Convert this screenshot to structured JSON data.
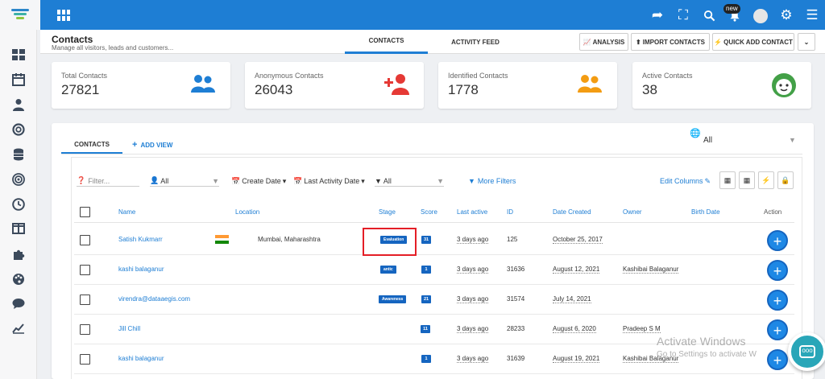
{
  "topbar": {
    "new_badge": "new",
    "icons": [
      "share-icon",
      "fullscreen-icon",
      "search-icon",
      "bell-icon",
      "avatar",
      "gear-icon",
      "menu-icon"
    ]
  },
  "sidebar": {
    "items": [
      "dashboard-icon",
      "calendar-icon",
      "user-icon",
      "lifebuoy-icon",
      "database-icon",
      "target-icon",
      "clock-icon",
      "columns-icon",
      "puzzle-icon",
      "palette-icon",
      "chat-icon",
      "trend-icon"
    ]
  },
  "header": {
    "title": "Contacts",
    "subtitle": "Manage all visitors, leads and customers...",
    "tabs": [
      {
        "label": "CONTACTS",
        "active": true
      },
      {
        "label": "ACTIVITY FEED",
        "active": false
      }
    ],
    "buttons": {
      "analysis": "ANALYSIS",
      "import": "IMPORT CONTACTS",
      "quick_add": "QUICK ADD CONTACT"
    }
  },
  "stats": [
    {
      "label": "Total Contacts",
      "value": "27821",
      "icon": "users-icon",
      "color": "#1e7ed4"
    },
    {
      "label": "Anonymous Contacts",
      "value": "26043",
      "icon": "add-user-icon",
      "color": "#e53935"
    },
    {
      "label": "Identified Contacts",
      "value": "1778",
      "icon": "users-icon",
      "color": "#f39c12"
    },
    {
      "label": "Active Contacts",
      "value": "38",
      "icon": "smiley-icon",
      "color": "#43a047"
    }
  ],
  "panel": {
    "tabs": {
      "contacts": "CONTACTS",
      "add_view": "ADD VIEW"
    },
    "scope": "All",
    "filters": {
      "filter_placeholder": "Filter...",
      "owner": "All",
      "create_date": "Create Date",
      "last_activity": "Last Activity Date",
      "type": "All",
      "more": "More Filters",
      "edit_columns": "Edit Columns"
    }
  },
  "table": {
    "columns": [
      "Name",
      "Location",
      "Stage",
      "Score",
      "Last active",
      "ID",
      "Date Created",
      "Owner",
      "Birth Date",
      "Action"
    ],
    "rows": [
      {
        "name": "Satish Kukmarr",
        "location": "Mumbai, Maharashtra",
        "stage": "Evaluation",
        "score": "31",
        "last_active": "3 days ago",
        "id": "125",
        "date_created": "October 25, 2017",
        "owner": "",
        "birth_date": ""
      },
      {
        "name": "kashi balaganur",
        "location": "",
        "stage": "antic",
        "score": "1",
        "last_active": "3 days ago",
        "id": "31636",
        "date_created": "August 12, 2021",
        "owner": "Kashibai Balaganur",
        "birth_date": ""
      },
      {
        "name": "virendra@dataaegis.com",
        "location": "",
        "stage": "Awareness",
        "score": "21",
        "last_active": "3 days ago",
        "id": "31574",
        "date_created": "July 14, 2021",
        "owner": "",
        "birth_date": ""
      },
      {
        "name": "Jill Chill",
        "location": "",
        "stage": "",
        "score": "11",
        "last_active": "3 days ago",
        "id": "28233",
        "date_created": "August 6, 2020",
        "owner": "Pradeep S M",
        "birth_date": ""
      },
      {
        "name": "kashi balaganur",
        "location": "",
        "stage": "",
        "score": "1",
        "last_active": "3 days ago",
        "id": "31639",
        "date_created": "August 19, 2021",
        "owner": "Kashibai Balaganur",
        "birth_date": ""
      }
    ]
  },
  "watermark": {
    "line1": "Activate Windows",
    "line2": "Go to Settings to activate W"
  },
  "chat_bubble": "ooo"
}
